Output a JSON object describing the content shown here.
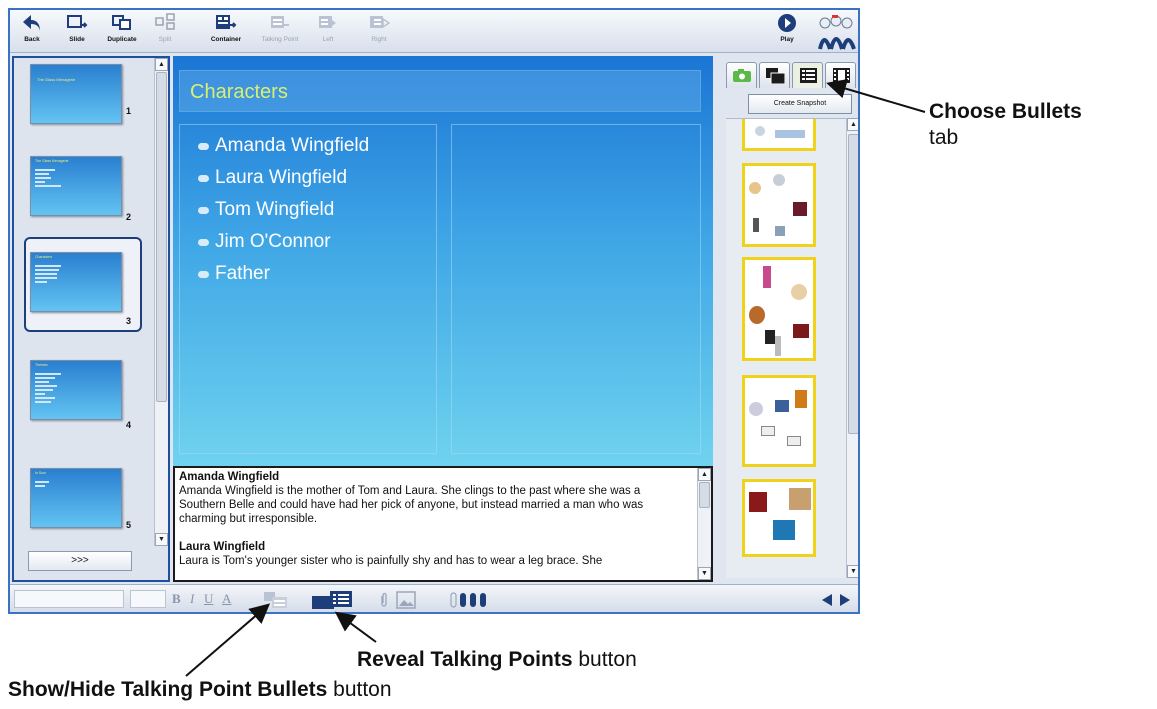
{
  "toolbar": {
    "back": "Back",
    "slide": "Slide",
    "duplicate": "Duplicate",
    "split": "Split",
    "container": "Container",
    "talking_point": "Talking Point",
    "left": "Left",
    "right": "Right",
    "play": "Play"
  },
  "sorter": {
    "slides": [
      {
        "num": "1",
        "title": "The Glass Menagerie"
      },
      {
        "num": "2",
        "title": "The Glass Menagerie"
      },
      {
        "num": "3",
        "title": "Characters"
      },
      {
        "num": "4",
        "title": "Themes"
      },
      {
        "num": "5",
        "title": "In Sum"
      }
    ],
    "more": ">>>"
  },
  "slide": {
    "title": "Characters",
    "bullets": [
      "Amanda Wingfield",
      "Laura Wingfield",
      "Tom Wingfield",
      "Jim O'Connor",
      "Father"
    ]
  },
  "notes": {
    "heading1": "Amanda Wingfield",
    "body1": "Amanda Wingfield is the mother of Tom and Laura. She clings to the past where she was a Southern Belle and could have had her pick of anyone, but instead married a man who was charming but irresponsible.",
    "heading2": "Laura Wingfield",
    "body2": "Laura is Tom's younger sister who is painfully shy and has to wear a leg brace. She"
  },
  "right_panel": {
    "snapshot_button": "Create Snapshot",
    "selected_tab": "bullets"
  },
  "callouts": {
    "choose_bold": "Choose Bullets",
    "choose_rest": "tab",
    "reveal_bold": "Reveal Talking Points",
    "reveal_rest": "button",
    "showhide_bold": "Show/Hide Talking Point Bullets",
    "showhide_rest": "button"
  },
  "colors": {
    "window_border": "#3b73c4",
    "slide_title": "#d8f070",
    "thumb_frame": "#f0d21a"
  }
}
